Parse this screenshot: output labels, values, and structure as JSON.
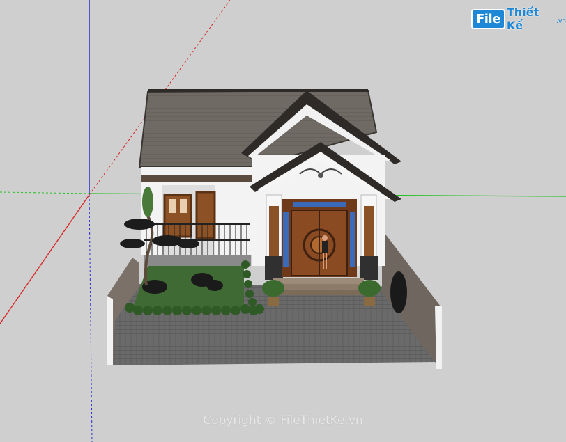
{
  "watermark": {
    "logo_file": "File",
    "logo_rest": "Thiết Kế",
    "logo_suffix": ".vn",
    "copyright": "Copyright © FileThietKe.vn"
  },
  "colors": {
    "background": "#cfcfcf",
    "axis_blue": "#2a2ad8",
    "axis_green": "#22c022",
    "axis_red": "#d82020",
    "roof": "#6e6862",
    "wall": "#f2f2f2",
    "paving": "#7a7a7a",
    "lawn": "#3f6a34",
    "door_wood": "#7a4020",
    "brand_blue": "#1e88d6"
  }
}
